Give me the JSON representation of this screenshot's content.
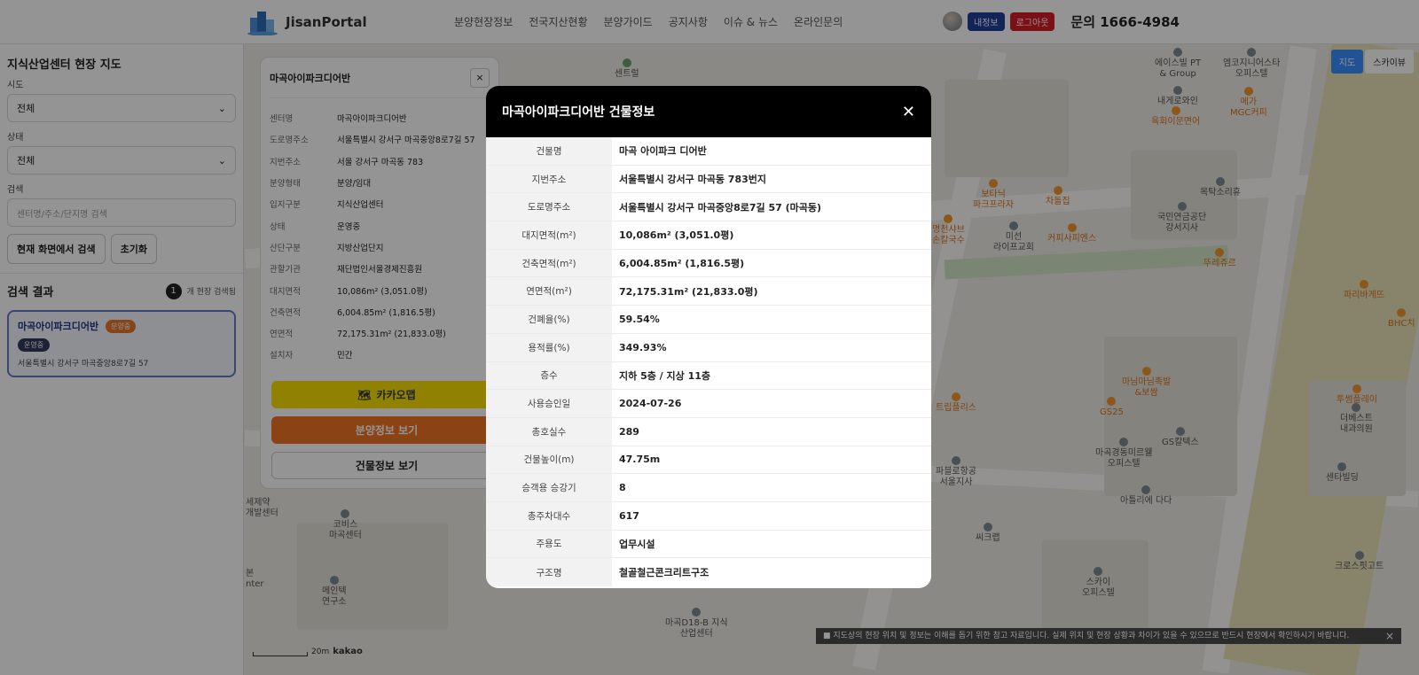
{
  "header": {
    "logo_text": "JisanPortal",
    "nav": [
      "분양현장정보",
      "전국지산현황",
      "분양가이드",
      "공지사항",
      "이슈 & 뉴스",
      "온라인문의"
    ],
    "myinfo_label": "내정보",
    "logout_label": "로그아웃",
    "phone": "문의 1666-4984"
  },
  "sidebar": {
    "title": "지식산업센터 현장 지도",
    "region_label": "시도",
    "region_value": "전체",
    "status_label": "상태",
    "status_value": "전체",
    "search_label": "검색",
    "search_placeholder": "센터명/주소/단지명 검색",
    "search_here_btn": "현재 화면에서 검색",
    "reset_btn": "초기화",
    "results_title": "검색 결과",
    "results_count": "1",
    "results_suffix": "개 현장 검색됨",
    "result": {
      "name": "마곡아이파크디어반",
      "badge_sale": "분양중",
      "badge_status": "운영중",
      "address": "서울특별시 강서구 마곡중앙8로7길 57"
    }
  },
  "info_panel": {
    "title": "마곡아이파크디어반",
    "close": "×",
    "rows": [
      {
        "k": "센터명",
        "v": "마곡아이파크디어반"
      },
      {
        "k": "도로명주소",
        "v": "서울특별시 강서구 마곡중앙8로7길 57"
      },
      {
        "k": "지번주소",
        "v": "서울 강서구 마곡동 783"
      },
      {
        "k": "분양형태",
        "v": "분양/임대"
      },
      {
        "k": "입지구분",
        "v": "지식산업센터"
      },
      {
        "k": "상태",
        "v": "운영중"
      },
      {
        "k": "산단구분",
        "v": "지방산업단지"
      },
      {
        "k": "관할기관",
        "v": "재단법인서울경제진흥원"
      },
      {
        "k": "대지면적",
        "v": "10,086m² (3,051.0평)"
      },
      {
        "k": "건축면적",
        "v": "6,004.85m² (1,816.5평)"
      },
      {
        "k": "연면적",
        "v": "72,175.31m² (21,833.0평)"
      },
      {
        "k": "설치자",
        "v": "민간"
      }
    ],
    "kakao_btn": "카카오맵",
    "sale_btn": "분양정보 보기",
    "building_btn": "건물정보 보기"
  },
  "map": {
    "toggle": [
      "지도",
      "스카이뷰"
    ],
    "notice": "■ 지도상의 현장 위치 및 정보는 이해를 돕기 위한 참고 자료입니다. 실제 위치 및 현장 상황과 차이가 있을 수 있으므로 반드시 현장에서 확인하시기 바랍니다.",
    "notice_close": "×",
    "scale": "20m",
    "brand": "kakao",
    "pois": [
      {
        "name": "에이스빌 PT\n& Group",
        "c": "gray"
      },
      {
        "name": "엠코지니어스타\n오피스텔",
        "c": "gray"
      },
      {
        "name": "내게로와인",
        "c": "gray"
      },
      {
        "name": "메가\nMGC커피",
        "c": "orange"
      },
      {
        "name": "육회이문면어",
        "c": "orange"
      },
      {
        "name": "보타닉\n파크프라자",
        "c": "orange"
      },
      {
        "name": "차돌집",
        "c": "orange"
      },
      {
        "name": "명천샤브\n손칼국수",
        "c": "orange"
      },
      {
        "name": "미선\n라이프교회",
        "c": "gray"
      },
      {
        "name": "커피사피엔스",
        "c": "orange"
      },
      {
        "name": "목탁소리휴",
        "c": "gray"
      },
      {
        "name": "국민연금공단\n강서지사",
        "c": "gray"
      },
      {
        "name": "뚜레쥬르",
        "c": "orange"
      },
      {
        "name": "파리바게뜨",
        "c": "orange"
      },
      {
        "name": "BHC치",
        "c": "orange"
      },
      {
        "name": "트립플리스",
        "c": "orange"
      },
      {
        "name": "마님마님족발\n&보쌈",
        "c": "orange"
      },
      {
        "name": "GS25",
        "c": "orange"
      },
      {
        "name": "GS칼텍스",
        "c": "gray"
      },
      {
        "name": "마곡경동미르웰\n오피스텔",
        "c": "gray"
      },
      {
        "name": "투썸플레이",
        "c": "orange"
      },
      {
        "name": "더베스트\n내과의원",
        "c": "gray"
      },
      {
        "name": "센타빌딩",
        "c": "gray"
      },
      {
        "name": "아틀리에 다다",
        "c": "gray"
      },
      {
        "name": "파블로항공\n서울지사",
        "c": "gray"
      },
      {
        "name": "씨크랩",
        "c": "gray"
      },
      {
        "name": "스카이\n오피스텔",
        "c": "gray"
      },
      {
        "name": "크로스핏고트",
        "c": "gray"
      },
      {
        "name": "코비스\n마곡센터",
        "c": "gray"
      },
      {
        "name": "메인텍\n연구소",
        "c": "gray"
      },
      {
        "name": "마곡D18-B 지식\n산업센터",
        "c": "gray"
      },
      {
        "name": "센트럴",
        "c": "gray"
      },
      {
        "name": "세제약\n개발센터",
        "c": "gray"
      },
      {
        "name": "본\nnter",
        "c": "gray"
      }
    ]
  },
  "modal": {
    "title": "마곡아이파크디어반 건물정보",
    "close": "✕",
    "rows": [
      {
        "k": "건물명",
        "v": "마곡 아이파크 디어반"
      },
      {
        "k": "지번주소",
        "v": "서울특별시 강서구 마곡동 783번지"
      },
      {
        "k": "도로명주소",
        "v": "서울특별시 강서구 마곡중앙8로7길 57 (마곡동)"
      },
      {
        "k": "대지면적(m²)",
        "v": "10,086m² (3,051.0평)"
      },
      {
        "k": "건축면적(m²)",
        "v": "6,004.85m² (1,816.5평)"
      },
      {
        "k": "연면적(m²)",
        "v": "72,175.31m² (21,833.0평)"
      },
      {
        "k": "건폐율(%)",
        "v": "59.54%"
      },
      {
        "k": "용적률(%)",
        "v": "349.93%"
      },
      {
        "k": "층수",
        "v": "지하 5층 / 지상 11층"
      },
      {
        "k": "사용승인일",
        "v": "2024-07-26"
      },
      {
        "k": "총호실수",
        "v": "289"
      },
      {
        "k": "건물높이(m)",
        "v": "47.75m"
      },
      {
        "k": "승객용 승강기",
        "v": "8"
      },
      {
        "k": "총주차대수",
        "v": "617"
      },
      {
        "k": "주용도",
        "v": "업무시설"
      },
      {
        "k": "구조명",
        "v": "철골철근콘크리트구조"
      }
    ]
  }
}
